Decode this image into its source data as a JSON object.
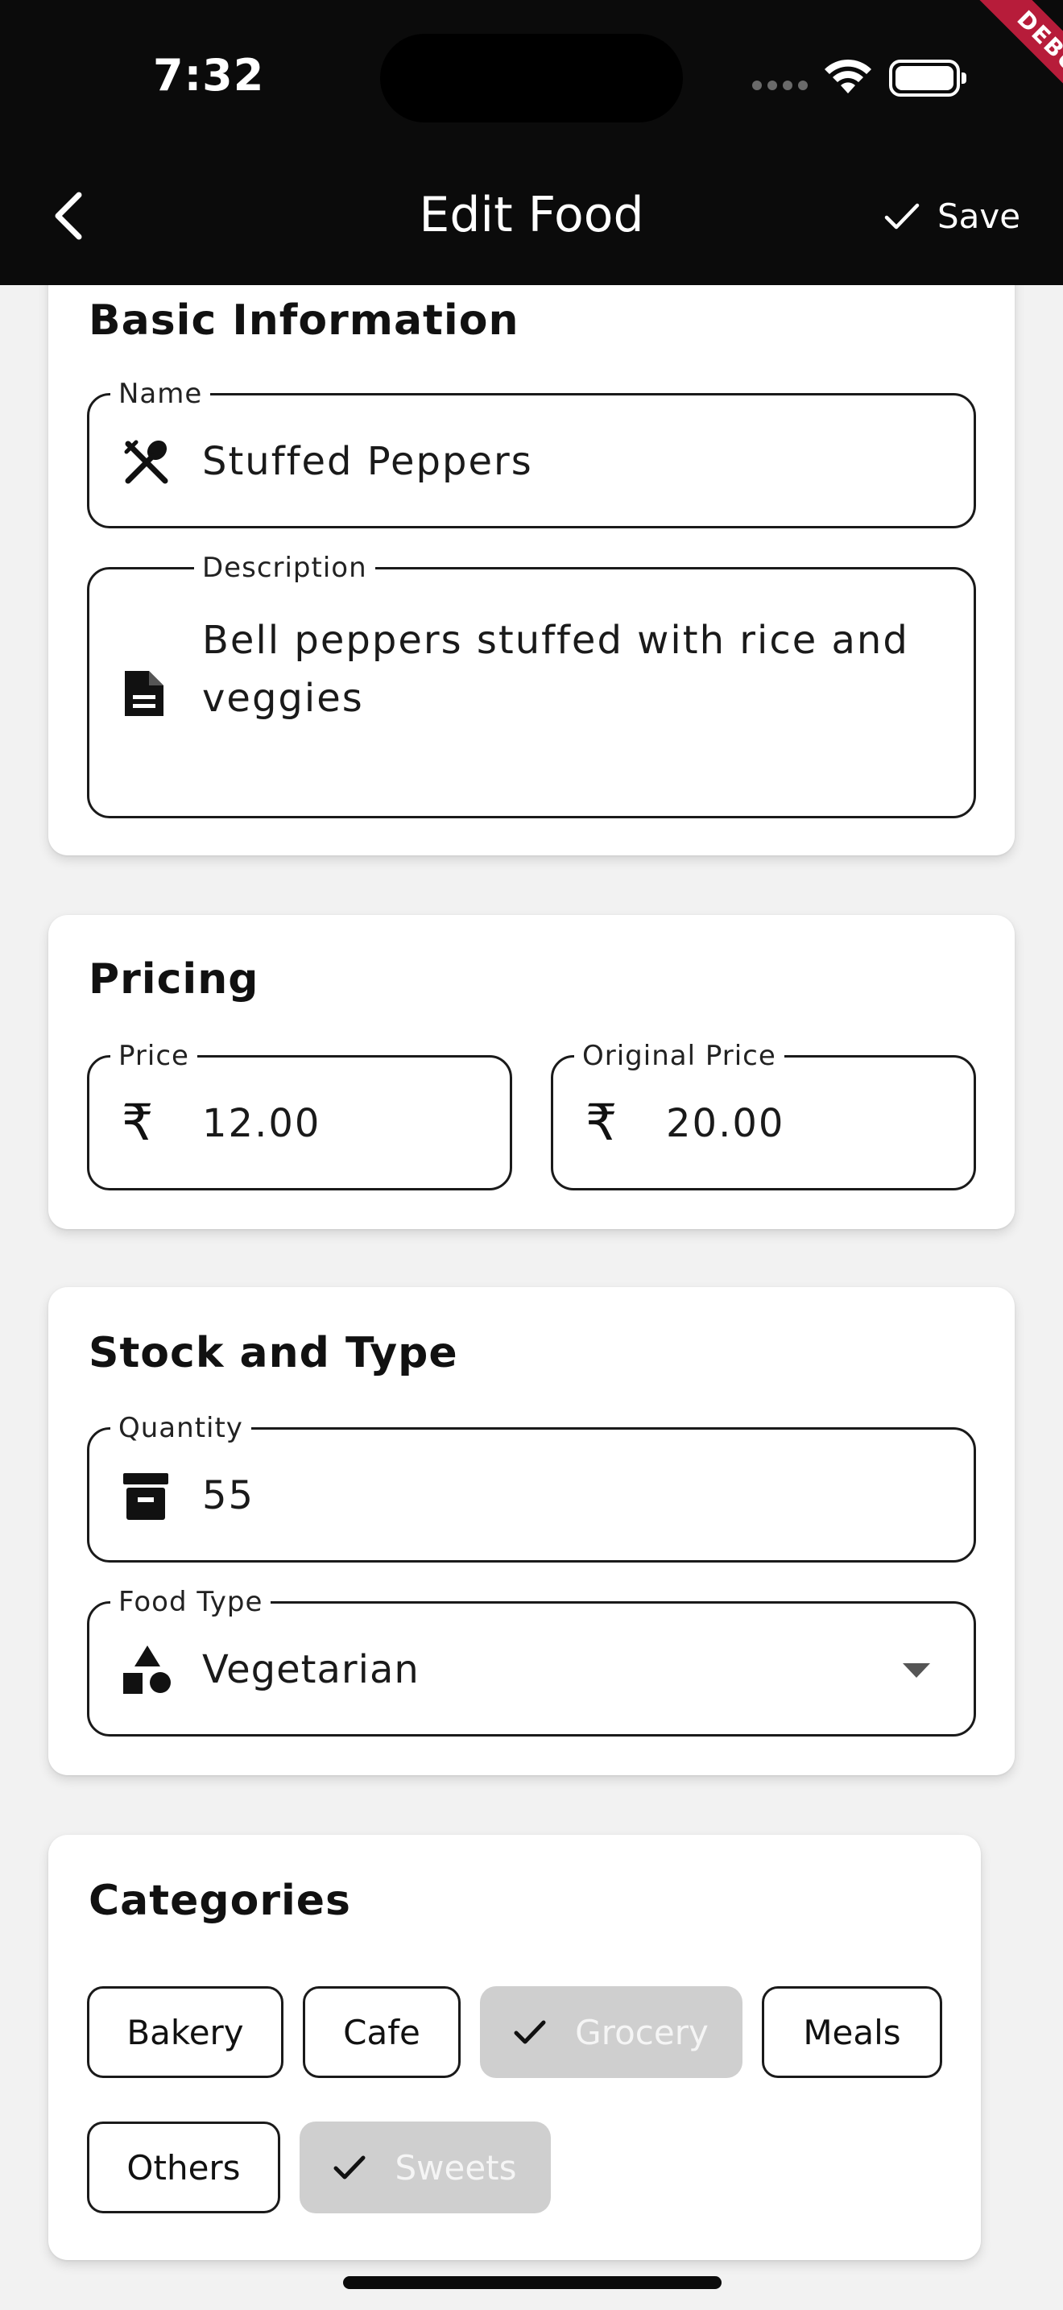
{
  "status_bar": {
    "time": "7:32",
    "debug_label": "DEBUG"
  },
  "app_bar": {
    "title": "Edit Food",
    "save_label": "Save"
  },
  "basic_info": {
    "title": "Basic Information",
    "name": {
      "label": "Name",
      "value": "Stuffed Peppers",
      "icon": "restaurant-icon"
    },
    "description": {
      "label": "Description",
      "value_line1": "Bell peppers stuffed with rice and",
      "value_line2": "veggies",
      "icon": "document-icon"
    }
  },
  "pricing": {
    "title": "Pricing",
    "price": {
      "label": "Price",
      "value": "12.00",
      "icon": "rupee-icon",
      "symbol": "₹"
    },
    "original_price": {
      "label": "Original Price",
      "value": "20.00",
      "icon": "rupee-icon",
      "symbol": "₹"
    }
  },
  "stock": {
    "title": "Stock and Type",
    "quantity": {
      "label": "Quantity",
      "value": "55",
      "icon": "inventory-box-icon"
    },
    "food_type": {
      "label": "Food Type",
      "value": "Vegetarian",
      "icon": "category-shapes-icon"
    }
  },
  "categories": {
    "title": "Categories",
    "chips": [
      {
        "label": "Bakery",
        "selected": false
      },
      {
        "label": "Cafe",
        "selected": false
      },
      {
        "label": "Grocery",
        "selected": true
      },
      {
        "label": "Meals",
        "selected": false
      },
      {
        "label": "Others",
        "selected": false
      },
      {
        "label": "Sweets",
        "selected": true
      }
    ]
  },
  "colors": {
    "app_bar": "#0b0b0b",
    "debug_banner": "#b71c3a",
    "selected_chip": "#cfcfcf"
  }
}
